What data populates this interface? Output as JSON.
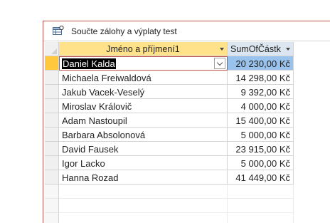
{
  "tab": {
    "icon": "query-datasheet-icon",
    "title": "Součte zálohy a výplaty test"
  },
  "columns": {
    "name": "Jméno a příjmení1",
    "sum": "SumOfČástk"
  },
  "rows": [
    {
      "name": "Daniel Kalda",
      "sum": "20 230,00 Kč"
    },
    {
      "name": "Michaela Freiwaldová",
      "sum": "14 298,00 Kč"
    },
    {
      "name": "Jakub Vacek-Veselý",
      "sum": "9 392,00 Kč"
    },
    {
      "name": "Miroslav Královič",
      "sum": "4 000,00 Kč"
    },
    {
      "name": "Adam Nastoupil",
      "sum": "15 400,00 Kč"
    },
    {
      "name": "Barbara Absolonová",
      "sum": "5 000,00 Kč"
    },
    {
      "name": "David Fausek",
      "sum": "23 915,00 Kč"
    },
    {
      "name": "Igor Lacko",
      "sum": "5 000,00 Kč"
    },
    {
      "name": "Hanna Rozad",
      "sum": "41 449,00 Kč"
    }
  ],
  "colors": {
    "active_header": "#ffe28a",
    "current_record_selector": "#ffc83d",
    "current_cell_highlight": "#99c2ec",
    "window_border": "#c0504d"
  }
}
